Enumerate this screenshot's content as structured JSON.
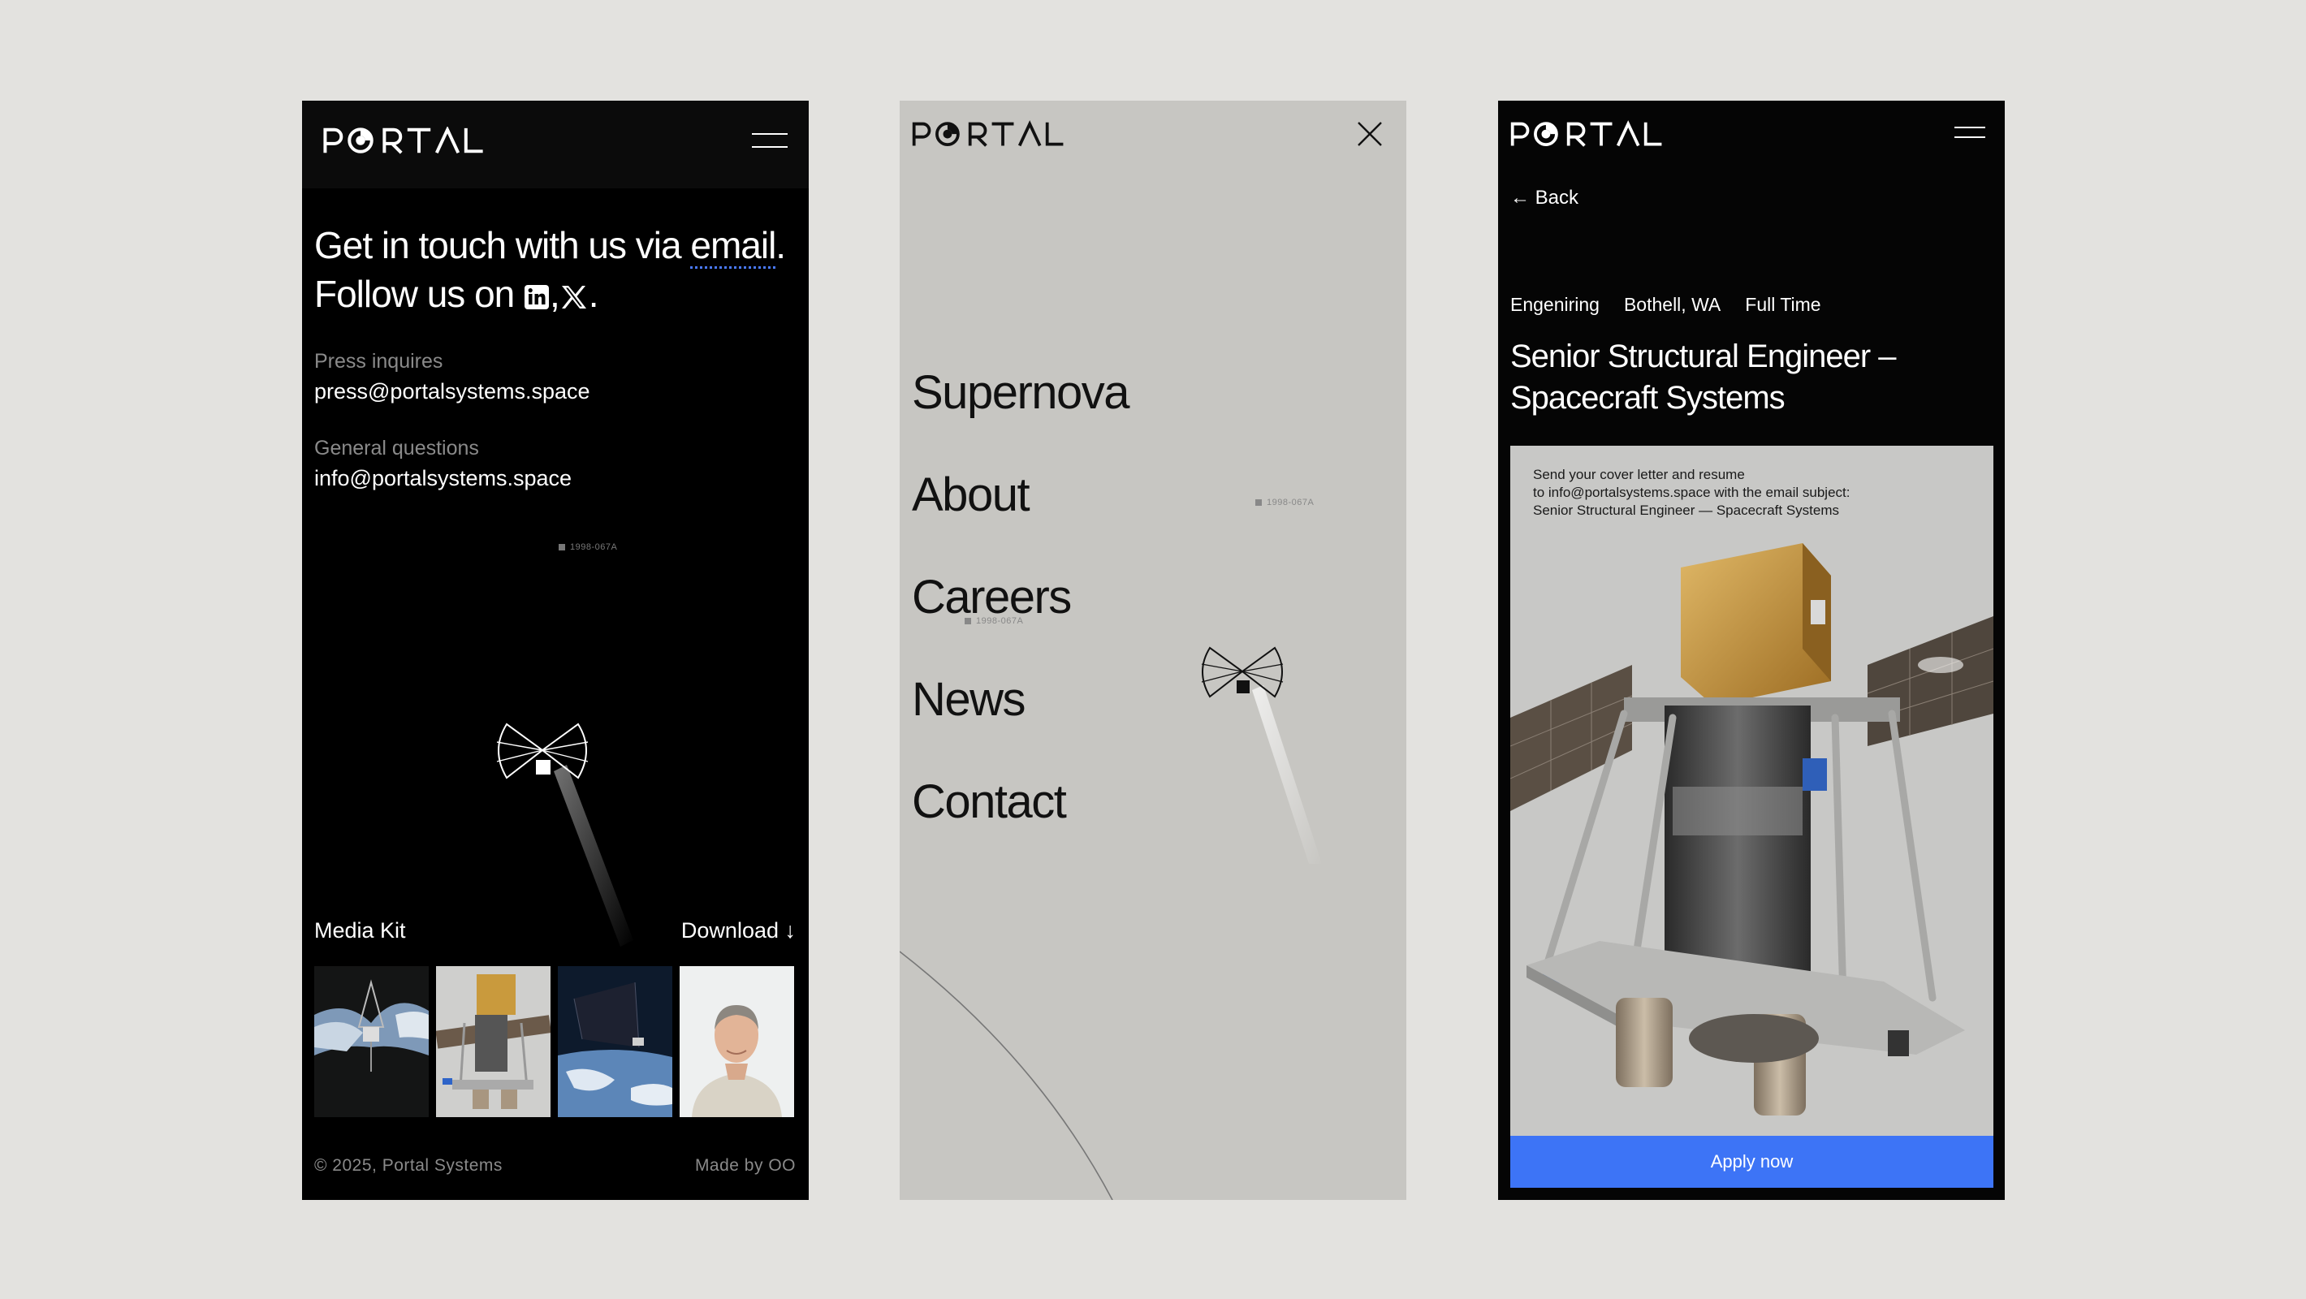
{
  "brand": {
    "logo_text": "PORTAL"
  },
  "contact_screen": {
    "headline_part1": "Get in touch with us via ",
    "headline_email": "email",
    "headline_part2": ". Follow us on ",
    "headline_comma": ",",
    "headline_end": ".",
    "press_label": "Press inquires",
    "press_email": "press@portalsystems.space",
    "general_label": "General questions",
    "general_email": "info@portalsystems.space",
    "object_tag": "1998-067A",
    "media_kit_label": "Media Kit",
    "download_label": "Download ↓",
    "thumbnails": [
      "antenna-over-earth",
      "spacecraft-render",
      "solar-panel-orbit",
      "team-portrait"
    ],
    "footer_copyright": "© 2025, Portal Systems",
    "footer_credit": "Made by OO"
  },
  "menu_screen": {
    "items": [
      "Supernova",
      "About",
      "Careers",
      "News",
      "Contact"
    ],
    "object_tag": "1998-067A"
  },
  "job_screen": {
    "back_label": "← Back",
    "tags": [
      "Engeniring",
      "Bothell, WA",
      "Full Time"
    ],
    "title": "Senior Structural Engineer – Spacecraft Systems",
    "instructions": [
      "Send your cover letter and resume",
      "to info@portalsystems.space with the email subject:",
      "Senior Structural Engineer — Spacecraft Systems"
    ],
    "apply_label": "Apply now"
  },
  "colors": {
    "page_background": "#e3e2df",
    "dark_screen": "#000000",
    "menu_screen": "#c7c6c2",
    "accent_blue": "#3d74f6",
    "link_underline": "#4a7aff"
  }
}
